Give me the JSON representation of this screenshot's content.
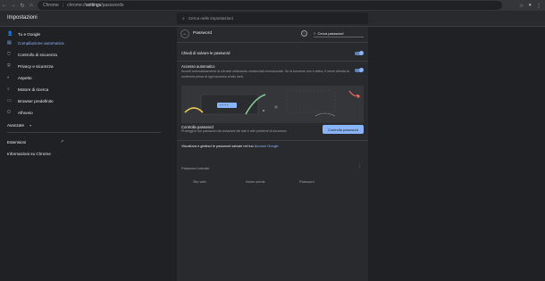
{
  "browser": {
    "back": "←",
    "forward": "→",
    "reload": "↻",
    "home": "⌂",
    "site_label": "Chrome",
    "url_prefix": "chrome://",
    "url_bold": "settings",
    "url_suffix": "/passwords",
    "star": "☆",
    "profile": "●",
    "menu": "⋮"
  },
  "header": {
    "title": "Impostazioni",
    "search_placeholder": "Cerca nelle impostazioni"
  },
  "sidebar": {
    "items": [
      {
        "label": "Tu e Google",
        "icon": "person-icon",
        "glyph": "👤"
      },
      {
        "label": "Compilazione automatica",
        "icon": "autofill-icon",
        "glyph": "▤"
      },
      {
        "label": "Controllo di sicurezza",
        "icon": "shield-check-icon",
        "glyph": "⛉"
      },
      {
        "label": "Privacy e sicurezza",
        "icon": "shield-icon",
        "glyph": "⛨"
      },
      {
        "label": "Aspetto",
        "icon": "palette-icon",
        "glyph": "◐"
      },
      {
        "label": "Motore di ricerca",
        "icon": "search-icon",
        "glyph": "⌕"
      },
      {
        "label": "Browser predefinito",
        "icon": "browser-icon",
        "glyph": "▭"
      },
      {
        "label": "All'avvio",
        "icon": "power-icon",
        "glyph": "⏻"
      }
    ],
    "avanzate": "Avanzate",
    "avanzate_arrow": "▾",
    "estensioni": "Estensioni",
    "estensioni_link": "↗",
    "info": "Informazioni su Chrome"
  },
  "passwords": {
    "back": "←",
    "title": "Password",
    "help": "?",
    "search_placeholder": "Cerca password",
    "offer_save_label": "Chiedi di salvare le password",
    "auto_signin_label": "Accesso automatico",
    "auto_signin_desc": "Accedi automaticamente ai siti web utilizzando credenziali memorizzate. Se la funzione non è attiva, ti viene chiesta la conferma prima di ogni accesso al sito web.",
    "check_title": "Controlla password",
    "check_desc": "Proteggi le tue password da violazioni dei dati e altri problemi di sicurezza",
    "check_button": "Controlla password",
    "manage_text": "Visualizza e gestisci le password salvate nel tuo",
    "manage_link": "Account Google",
    "saved_title": "Password salvate",
    "kebab": "⋮",
    "columns": [
      "Sito web",
      "Nome utente",
      "Password"
    ]
  },
  "colors": {
    "accent": "#8ab4f8",
    "bg": "#202124",
    "card": "#292a2d"
  }
}
